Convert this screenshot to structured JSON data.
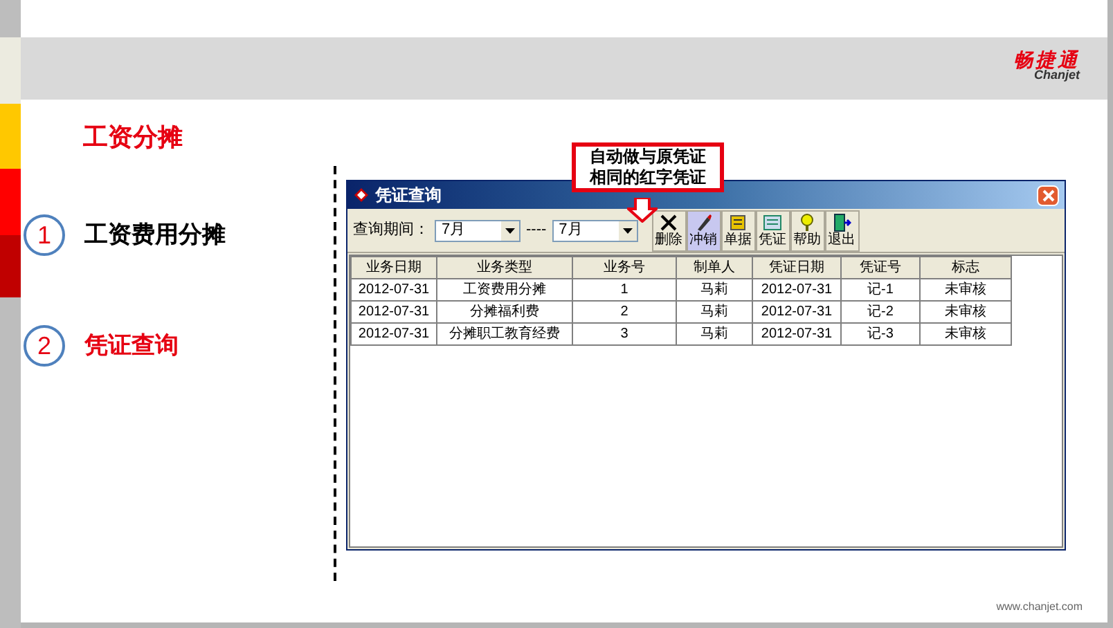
{
  "logo": {
    "name": "畅捷通",
    "latin": "Chanjet"
  },
  "slide_title": "工资分摊",
  "steps": [
    {
      "number": "1",
      "label": "工资费用分摊",
      "selected": false
    },
    {
      "number": "2",
      "label": "凭证查询",
      "selected": true
    }
  ],
  "callout": "自动做与原凭证相同的红字凭证",
  "window": {
    "title": "凭证查询",
    "period": {
      "label": "查询期间：",
      "from": "7月",
      "separator": "----",
      "to": "7月"
    },
    "toolbar": [
      {
        "kind": "delete",
        "label": "删除",
        "selected": false
      },
      {
        "kind": "reverse",
        "label": "冲销",
        "selected": true
      },
      {
        "kind": "document",
        "label": "单据",
        "selected": false
      },
      {
        "kind": "voucher",
        "label": "凭证",
        "selected": false
      },
      {
        "kind": "help",
        "label": "帮助",
        "selected": false
      },
      {
        "kind": "exit",
        "label": "退出",
        "selected": false
      }
    ],
    "table": {
      "columns": [
        "业务日期",
        "业务类型",
        "业务号",
        "制单人",
        "凭证日期",
        "凭证号",
        "标志"
      ],
      "rows": [
        [
          "2012-07-31",
          "工资费用分摊",
          "1",
          "马莉",
          "2012-07-31",
          "记-1",
          "未审核"
        ],
        [
          "2012-07-31",
          "分摊福利费",
          "2",
          "马莉",
          "2012-07-31",
          "记-2",
          "未审核"
        ],
        [
          "2012-07-31",
          "分摊职工教育经费",
          "3",
          "马莉",
          "2012-07-31",
          "记-3",
          "未审核"
        ]
      ]
    }
  },
  "footer": "www.chanjet.com"
}
